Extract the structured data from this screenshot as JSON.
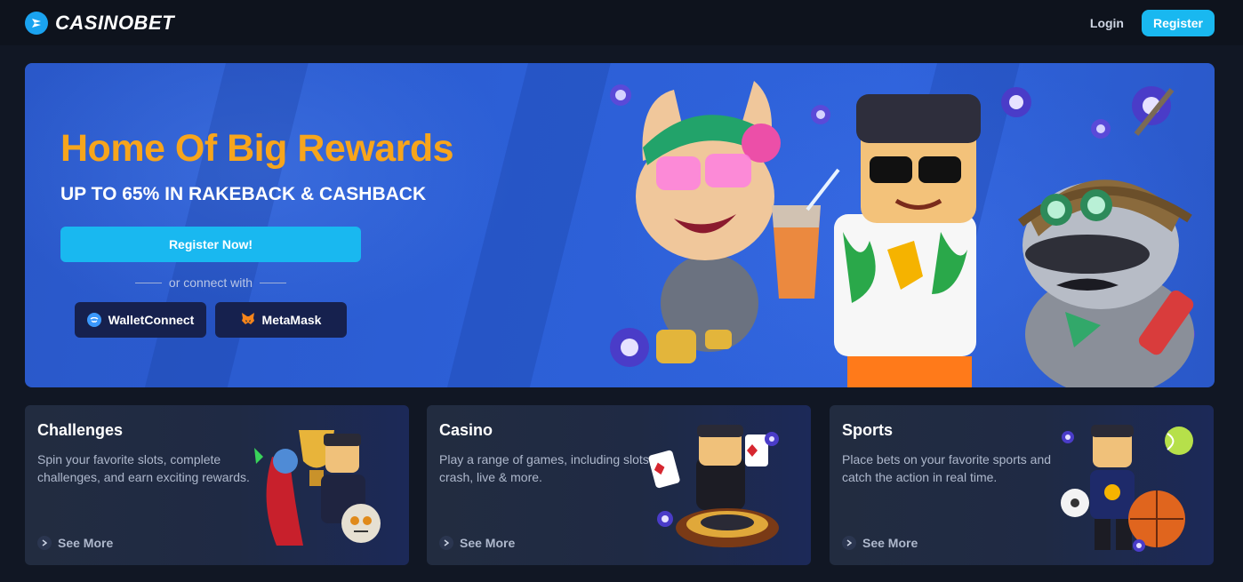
{
  "header": {
    "brand": "CASINOBET",
    "login_label": "Login",
    "register_label": "Register"
  },
  "hero": {
    "title": "Home Of Big Rewards",
    "subtitle": "UP TO 65% IN RAKEBACK & CASHBACK",
    "cta_label": "Register Now!",
    "connect_text": "or connect with",
    "wallets": [
      {
        "label": "WalletConnect",
        "icon": "walletconnect-icon"
      },
      {
        "label": "MetaMask",
        "icon": "metamask-icon"
      }
    ]
  },
  "cards": [
    {
      "title": "Challenges",
      "description": "Spin your favorite slots, complete challenges, and earn exciting rewards.",
      "link_label": "See More"
    },
    {
      "title": "Casino",
      "description": "Play a range of games, including slots, crash, live & more.",
      "link_label": "See More"
    },
    {
      "title": "Sports",
      "description": "Place bets on your favorite sports and catch the action in real time.",
      "link_label": "See More"
    }
  ],
  "colors": {
    "accent": "#19b8f0",
    "title_orange": "#f7a51c",
    "background": "#111724",
    "card": "#222c40"
  }
}
